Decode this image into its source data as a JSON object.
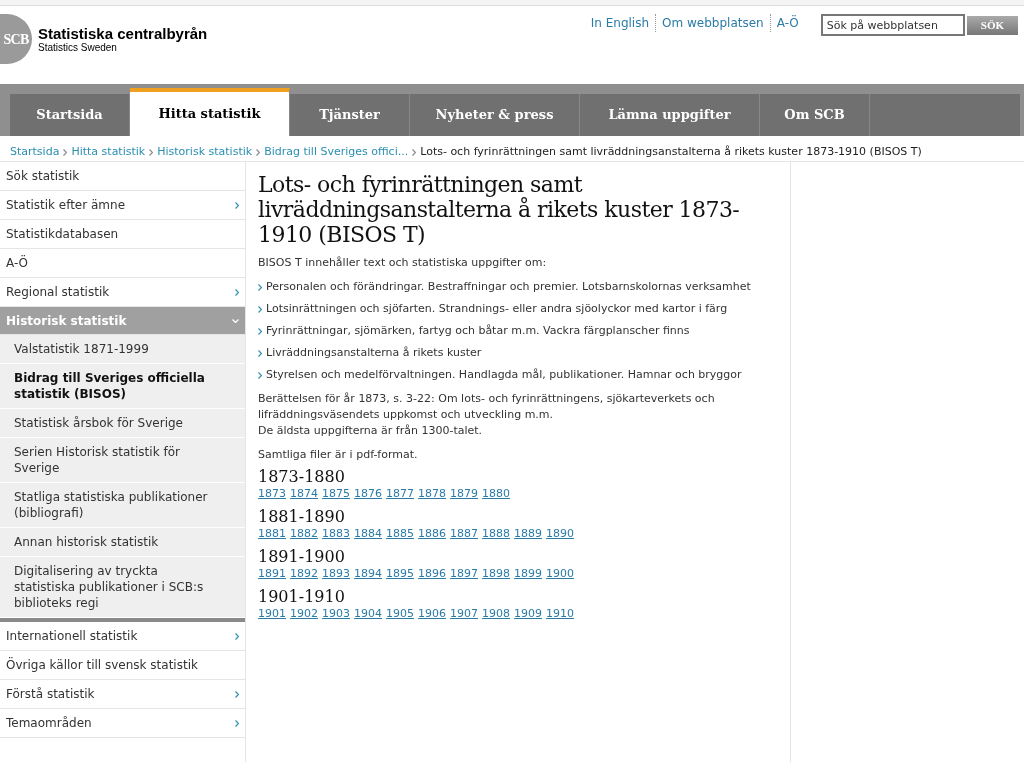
{
  "header": {
    "logo_mark": "SCB",
    "site_name": "Statistiska centralbyrån",
    "site_subtitle": "Statistics Sweden",
    "top_links": [
      "In English",
      "Om webbplatsen",
      "A-Ö"
    ],
    "search": {
      "placeholder": "Sök på webbplatsen",
      "button": "SÖK"
    }
  },
  "tabs": [
    {
      "label": "Startsida",
      "selected": false
    },
    {
      "label": "Hitta statistik",
      "selected": true
    },
    {
      "label": "Tjänster",
      "selected": false
    },
    {
      "label": "Nyheter & press",
      "selected": false
    },
    {
      "label": "Lämna uppgifter",
      "selected": false
    },
    {
      "label": "Om SCB",
      "selected": false
    }
  ],
  "breadcrumb": {
    "links": [
      "Startsida",
      "Hitta statistik",
      "Historisk statistik",
      "Bidrag till Sveriges offici..."
    ],
    "current": "Lots- och fyrinrättningen samt livräddningsanstalterna å rikets kuster 1873-1910 (BISOS T)"
  },
  "sidebar": {
    "items": [
      {
        "label": "Sök statistik",
        "expandable": false,
        "expanded": false
      },
      {
        "label": "Statistik efter ämne",
        "expandable": true,
        "expanded": false
      },
      {
        "label": "Statistikdatabasen",
        "expandable": false,
        "expanded": false
      },
      {
        "label": "A-Ö",
        "expandable": false,
        "expanded": false
      },
      {
        "label": "Regional statistik",
        "expandable": true,
        "expanded": false
      },
      {
        "label": "Historisk statistik",
        "expandable": true,
        "expanded": true,
        "children": [
          {
            "label": "Valstatistik 1871-1999",
            "selected": false
          },
          {
            "label": "Bidrag till Sveriges officiella statistik (BISOS)",
            "selected": true
          },
          {
            "label": "Statistisk årsbok för Sverige",
            "selected": false
          },
          {
            "label": "Serien Historisk statistik för Sverige",
            "selected": false
          },
          {
            "label": "Statliga statistiska publikationer (bibliografi)",
            "selected": false
          },
          {
            "label": "Annan historisk statistik",
            "selected": false
          },
          {
            "label": "Digitalisering av tryckta statistiska publikationer i SCB:s biblioteks regi",
            "selected": false
          }
        ]
      },
      {
        "label": "Internationell statistik",
        "expandable": true,
        "expanded": false
      },
      {
        "label": "Övriga källor till svensk statistik",
        "expandable": false,
        "expanded": false
      },
      {
        "label": "Förstå statistik",
        "expandable": true,
        "expanded": false
      },
      {
        "label": "Temaområden",
        "expandable": true,
        "expanded": false
      }
    ]
  },
  "content": {
    "title": "Lots- och fyrinrättningen samt livräddningsanstalterna å rikets kuster 1873-1910 (BISOS T)",
    "intro": "BISOS T innehåller text och statistiska uppgifter om:",
    "bullets": [
      "Personalen och förändringar. Bestraffningar och premier. Lotsbarnskolornas verksamhet",
      "Lotsinrättningen och sjöfarten. Strandnings- eller andra sjöolyckor med kartor i färg",
      "Fyrinrättningar, sjömärken, fartyg och båtar m.m. Vackra färgplanscher finns",
      "Livräddningsanstalterna å rikets kuster",
      "Styrelsen och medelförvaltningen. Handlagda mål, publikationer. Hamnar och bryggor"
    ],
    "notes": [
      "Berättelsen för år 1873, s. 3-22: Om lots- och fyrinrättningens, sjökarteverkets och lifräddningsväsendets uppkomst och utveckling m.m.",
      "De äldsta uppgifterna är från 1300-talet."
    ],
    "format_note": "Samtliga filer är i pdf-format.",
    "year_groups": [
      {
        "heading": "1873-1880",
        "years": [
          "1873",
          "1874",
          "1875",
          "1876",
          "1877",
          "1878",
          "1879",
          "1880"
        ]
      },
      {
        "heading": "1881-1890",
        "years": [
          "1881",
          "1882",
          "1883",
          "1884",
          "1885",
          "1886",
          "1887",
          "1888",
          "1889",
          "1890"
        ]
      },
      {
        "heading": "1891-1900",
        "years": [
          "1891",
          "1892",
          "1893",
          "1894",
          "1895",
          "1896",
          "1897",
          "1898",
          "1899",
          "1900"
        ]
      },
      {
        "heading": "1901-1910",
        "years": [
          "1901",
          "1902",
          "1903",
          "1904",
          "1905",
          "1906",
          "1907",
          "1908",
          "1909",
          "1910"
        ]
      }
    ]
  }
}
